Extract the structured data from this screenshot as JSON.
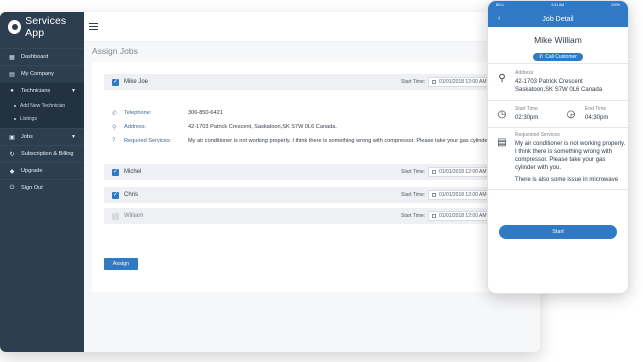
{
  "brand": {
    "name": "Services App"
  },
  "sidebar": {
    "items": [
      {
        "label": "Dashboard",
        "icon": "grid-icon"
      },
      {
        "label": "My Company",
        "icon": "building-icon"
      },
      {
        "label": "Technicians",
        "icon": "users-icon"
      },
      {
        "label": "Jobs",
        "icon": "briefcase-icon"
      },
      {
        "label": "Subscription & Billing",
        "icon": "refresh-icon"
      },
      {
        "label": "Upgrade",
        "icon": "upgrade-icon"
      },
      {
        "label": "Sign Out",
        "icon": "power-icon"
      }
    ],
    "subitems": [
      {
        "label": "Add New Technician"
      },
      {
        "label": "Listings"
      }
    ]
  },
  "page": {
    "title": "Assign Jobs"
  },
  "jobs": {
    "start_label": "Start Time:",
    "rows": [
      {
        "name": "Mike Joe",
        "checked": true,
        "start": "01/01/2018 12:00 AM"
      },
      {
        "name": "Michel",
        "checked": true,
        "start": "01/01/2018 12:00 AM"
      },
      {
        "name": "Chris",
        "checked": true,
        "start": "01/01/2018 12:00 AM"
      },
      {
        "name": "William",
        "checked": false,
        "start": "01/01/2018 12:00 AM"
      }
    ],
    "details": {
      "telephone_label": "Telephone:",
      "telephone": "306-850-6421",
      "address_label": "Address:",
      "address": "42-1703 Patrick Crescent, Saskatoon,SK S7W 0L6 Canada.",
      "services_label": "Required Services:",
      "services": "My air conditioner is not working properly. I think there is something wrong with compressor. Please take your gas cylinder w"
    },
    "assign_label": "Assign"
  },
  "phone": {
    "status_left": "BELL",
    "status_center": "9:41 AM",
    "status_right": "100%",
    "title": "Job Detail",
    "name": "Mike William",
    "call_label": "Call Customer",
    "address_label": "Address",
    "address_line1": "42-1703 Patrick Crescent",
    "address_line2": "Saskatoon,SK S7W 0L6 Canada",
    "start_label": "Start Time",
    "start_time": "02:30pm",
    "end_label": "End Time",
    "end_time": "04:30pm",
    "services_label": "Requested Services",
    "services_text": "My air conditioner is not working properly. I think there is something wrong with compressor. Please take your gas cylinder with you.",
    "services_more": "There is also some issue in microwave",
    "start_button": "Start"
  },
  "colors": {
    "accent": "#2f79c5",
    "sidebar": "#2d3e50"
  }
}
